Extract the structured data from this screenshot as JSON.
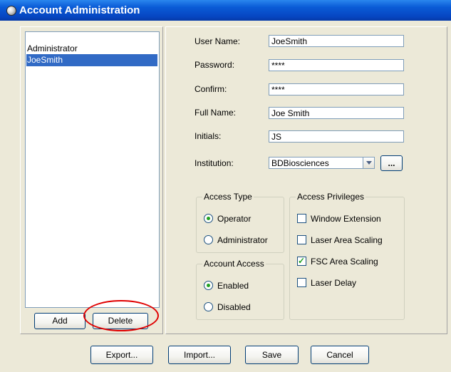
{
  "window": {
    "title": "Account Administration"
  },
  "user_list": {
    "items": [
      "Administrator",
      "JoeSmith"
    ],
    "selected": "JoeSmith"
  },
  "list_buttons": {
    "add": "Add",
    "delete": "Delete"
  },
  "form": {
    "user_name_label": "User Name:",
    "user_name_value": "JoeSmith",
    "password_label": "Password:",
    "password_value": "****",
    "confirm_label": "Confirm:",
    "confirm_value": "****",
    "full_name_label": "Full Name:",
    "full_name_value": "Joe Smith",
    "initials_label": "Initials:",
    "initials_value": "JS",
    "institution_label": "Institution:",
    "institution_value": "BDBiosciences",
    "institution_browse": "..."
  },
  "access_type": {
    "title": "Access Type",
    "options": [
      "Operator",
      "Administrator"
    ],
    "selected": "Operator"
  },
  "account_access": {
    "title": "Account Access",
    "options": [
      "Enabled",
      "Disabled"
    ],
    "selected": "Enabled"
  },
  "access_privileges": {
    "title": "Access Privileges",
    "items": [
      {
        "label": "Window Extension",
        "checked": false
      },
      {
        "label": "Laser Area Scaling",
        "checked": false
      },
      {
        "label": "FSC Area Scaling",
        "checked": true
      },
      {
        "label": "Laser Delay",
        "checked": false
      }
    ]
  },
  "footer_buttons": {
    "export": "Export...",
    "import": "Import...",
    "save": "Save",
    "cancel": "Cancel"
  },
  "colors": {
    "title_bar": "#0a5bd6",
    "selection": "#316ac5",
    "highlight_circle": "#e00000",
    "window_bg": "#ece9d8"
  }
}
